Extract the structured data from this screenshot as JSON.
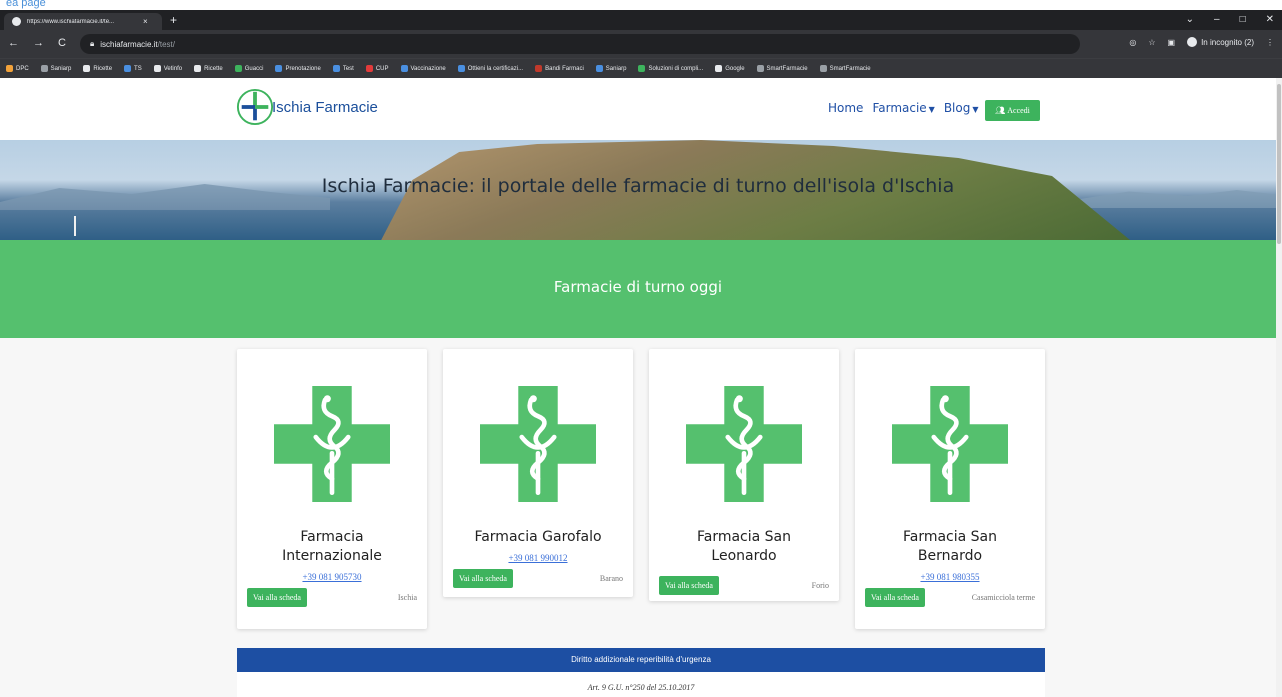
{
  "caption": "ea page",
  "browser": {
    "tab_title": "https://www.ischiafarmacie.it/te...",
    "tab_close": "×",
    "new_tab": "+",
    "window_controls": [
      "⌄",
      "–",
      "□",
      "✕"
    ],
    "nav": [
      "←",
      "→",
      "C"
    ],
    "url_host": "ischiafarmacie.it",
    "url_path": "/test/",
    "incognito_label": "In incognito (2)",
    "bookmarks": [
      {
        "label": "DPC",
        "color": "#f2a23a"
      },
      {
        "label": "Saniarp",
        "color": "#9aa0a6"
      },
      {
        "label": "Ricette",
        "color": "#e8eaed"
      },
      {
        "label": "TS",
        "color": "#4a8fe0"
      },
      {
        "label": "Vetinfo",
        "color": "#e8eaed"
      },
      {
        "label": "Ricette",
        "color": "#e8eaed"
      },
      {
        "label": "Guacci",
        "color": "#3db35d"
      },
      {
        "label": "Prenotazione",
        "color": "#4a8fe0"
      },
      {
        "label": "Test",
        "color": "#4a8fe0"
      },
      {
        "label": "CUP",
        "color": "#e23b3b"
      },
      {
        "label": "Vaccinazione",
        "color": "#4a8fe0"
      },
      {
        "label": "Ottieni la certificazi...",
        "color": "#4a8fe0"
      },
      {
        "label": "Bandi Farmaci",
        "color": "#c0392b"
      },
      {
        "label": "Saniarp",
        "color": "#4a8fe0"
      },
      {
        "label": "Soluzioni di compli...",
        "color": "#3db35d"
      },
      {
        "label": "Google",
        "color": "#e8eaed"
      },
      {
        "label": "SmartFarmacie",
        "color": "#9aa0a6"
      },
      {
        "label": "SmartFarmacie",
        "color": "#9aa0a6"
      }
    ]
  },
  "site": {
    "logo_text": "Ischia Farmacie",
    "menu": {
      "home": "Home",
      "farmacie": "Farmacie",
      "blog": "Blog",
      "caret": "▼"
    },
    "login_label": "Accedi",
    "hero_title": "Ischia Farmacie: il portale delle farmacie di turno dell'isola d'Ischia",
    "band_title": "Farmacie di turno oggi",
    "cards": [
      {
        "name": "Farmacia Internazionale",
        "phone": "+39 081 905730",
        "button": "Vai alla scheda",
        "location": "Ischia"
      },
      {
        "name": "Farmacia Garofalo",
        "phone": "+39 081 990012",
        "button": "Vai alla scheda",
        "location": "Barano"
      },
      {
        "name": "Farmacia San Leonardo",
        "phone": "",
        "button": "Vai alla scheda",
        "location": "Forio"
      },
      {
        "name": "Farmacia San Bernardo",
        "phone": "+39 081 980355",
        "button": "Vai alla scheda",
        "location": "Casamicciola terme"
      }
    ],
    "notice_title": "Diritto addizionale reperibilità d'urgenza",
    "notice_sub": "Art. 9 G.U. n°250 del 25.10.2017"
  },
  "colors": {
    "accent_green": "#55c06e",
    "button_green": "#3db35d",
    "brand_blue": "#1b4f9b",
    "notice_blue": "#1d4fa3"
  },
  "icons": [
    "pharmacy-cross-icon",
    "logo-cross-icon",
    "users-icon",
    "lock-icon",
    "star-icon",
    "incognito-icon"
  ]
}
